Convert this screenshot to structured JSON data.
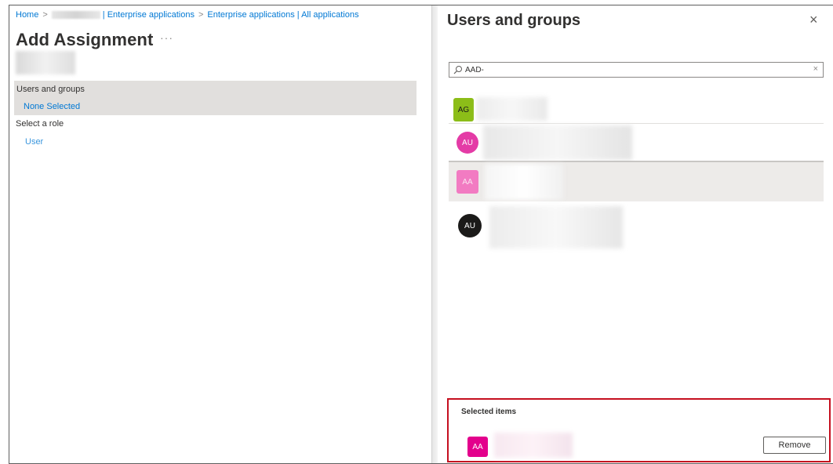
{
  "breadcrumb": {
    "home": "Home",
    "sep": ">",
    "crumb2": "| Enterprise applications",
    "crumb3": "Enterprise applications | All applications"
  },
  "page": {
    "title": "Add Assignment",
    "more": "···"
  },
  "assignment": {
    "users_label": "Users and groups",
    "users_value": "None Selected",
    "role_label": "Select a role",
    "role_value": "User"
  },
  "panel": {
    "title": "Users and groups",
    "close": "×",
    "search_value": "AAD-",
    "search_clear": "×",
    "results": [
      {
        "initials": "AG",
        "color": "#8cbd18",
        "shape": "square"
      },
      {
        "initials": "AU",
        "color": "#e43ba6",
        "shape": "circle"
      },
      {
        "initials": "AA",
        "color": "#f27bc2",
        "shape": "square"
      },
      {
        "initials": "AU",
        "color": "#1b1a19",
        "shape": "circle"
      }
    ]
  },
  "selected": {
    "title": "Selected items",
    "item_initials": "AA",
    "item_color": "#e3008c",
    "remove_label": "Remove"
  }
}
